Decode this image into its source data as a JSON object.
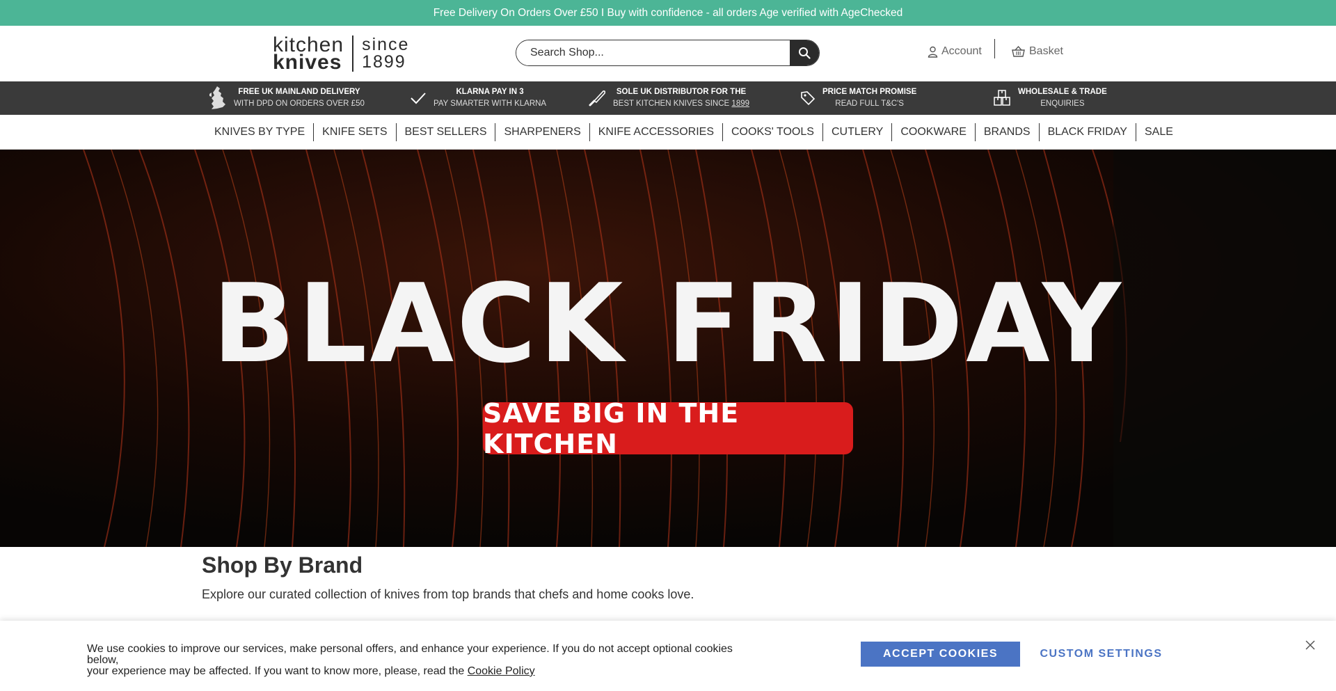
{
  "announcement": "Free Delivery On Orders Over £50 I Buy with confidence - all orders Age verified with AgeChecked",
  "logo": {
    "word1": "kitchen",
    "word2": "knives",
    "since1": "since",
    "since2": "1899"
  },
  "search": {
    "placeholder": "Search Shop..."
  },
  "account": {
    "label": "Account"
  },
  "basket": {
    "label": "Basket"
  },
  "usp": [
    {
      "title": "FREE UK MAINLAND DELIVERY",
      "sub": "WITH DPD ON ORDERS OVER £50",
      "icon": "uk-map-icon"
    },
    {
      "title": "KLARNA PAY IN 3",
      "sub": "PAY SMARTER WITH KLARNA",
      "icon": "check-icon"
    },
    {
      "title": "SOLE UK DISTRIBUTOR FOR THE",
      "sub_pre": "BEST KITCHEN KNIVES SINCE ",
      "sub_link": "1899",
      "icon": "knife-icon"
    },
    {
      "title": "PRICE MATCH PROMISE",
      "sub": "READ FULL T&C'S",
      "icon": "tag-icon"
    },
    {
      "title": "WHOLESALE & TRADE",
      "sub": "ENQUIRIES",
      "icon": "boxes-icon"
    }
  ],
  "nav": [
    "KNIVES BY TYPE",
    "KNIFE SETS",
    "BEST SELLERS",
    "SHARPENERS",
    "KNIFE ACCESSORIES",
    "COOKS' TOOLS",
    "CUTLERY",
    "COOKWARE",
    "BRANDS",
    "BLACK FRIDAY",
    "SALE"
  ],
  "hero": {
    "title": "BLACK FRIDAY",
    "cta": "SAVE BIG IN THE KITCHEN"
  },
  "brand_section": {
    "heading": "Shop By Brand",
    "subheading": "Explore our curated collection of knives from top brands that chefs and home cooks love."
  },
  "cookie": {
    "text_line1": "We use cookies to improve our services, make personal offers, and enhance your experience. If you do not accept optional cookies below,",
    "text_line2": "your experience may be affected. If you want to know more, please, read the",
    "link": "Cookie Policy",
    "accept": "ACCEPT COOKIES",
    "custom": "CUSTOM SETTINGS"
  },
  "colors": {
    "accent_green": "#4cb596",
    "usp_bg": "#3a3a3a",
    "cta_red": "#d91c1c",
    "cookie_blue": "#4b74c4"
  }
}
